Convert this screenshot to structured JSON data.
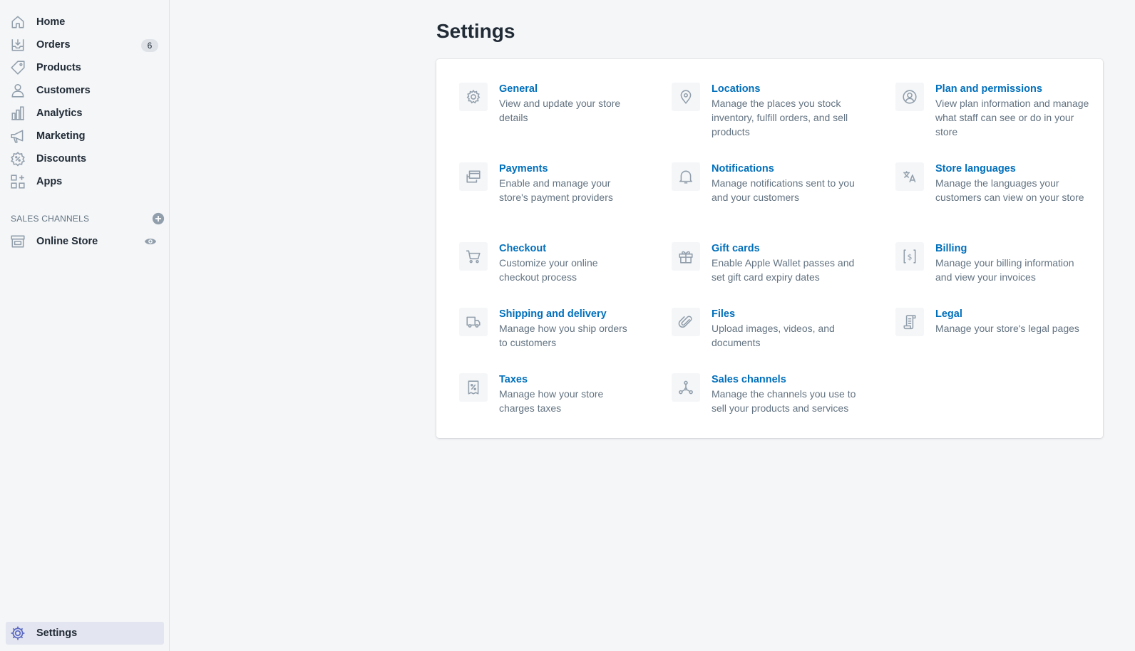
{
  "nav": {
    "items": [
      {
        "label": "Home",
        "icon": "home-icon"
      },
      {
        "label": "Orders",
        "icon": "orders-icon",
        "badge": "6"
      },
      {
        "label": "Products",
        "icon": "tag-icon"
      },
      {
        "label": "Customers",
        "icon": "person-icon"
      },
      {
        "label": "Analytics",
        "icon": "bar-chart-icon"
      },
      {
        "label": "Marketing",
        "icon": "megaphone-icon"
      },
      {
        "label": "Discounts",
        "icon": "discount-icon"
      },
      {
        "label": "Apps",
        "icon": "apps-icon"
      }
    ],
    "sales_channels_title": "SALES CHANNELS",
    "online_store": "Online Store",
    "settings": "Settings",
    "active_color": "#e3e5f0"
  },
  "page": {
    "title": "Settings"
  },
  "settings": [
    {
      "title": "General",
      "desc": "View and update your store details",
      "icon": "gear-icon"
    },
    {
      "title": "Locations",
      "desc": "Manage the places you stock inventory, fulfill orders, and sell products",
      "icon": "location-pin-icon"
    },
    {
      "title": "Plan and permissions",
      "desc": "View plan information and manage what staff can see or do in your store",
      "icon": "user-circle-icon"
    },
    {
      "title": "Payments",
      "desc": "Enable and manage your store's payment providers",
      "icon": "payment-icon"
    },
    {
      "title": "Notifications",
      "desc": "Manage notifications sent to you and your customers",
      "icon": "bell-icon"
    },
    {
      "title": "Store languages",
      "desc": "Manage the languages your customers can view on your store",
      "icon": "translate-icon"
    },
    {
      "title": "Checkout",
      "desc": "Customize your online checkout process",
      "icon": "cart-icon"
    },
    {
      "title": "Gift cards",
      "desc": "Enable Apple Wallet passes and set gift card expiry dates",
      "icon": "gift-icon"
    },
    {
      "title": "Billing",
      "desc": "Manage your billing information and view your invoices",
      "icon": "billing-icon"
    },
    {
      "title": "Shipping and delivery",
      "desc": "Manage how you ship orders to customers",
      "icon": "truck-icon"
    },
    {
      "title": "Files",
      "desc": "Upload images, videos, and documents",
      "icon": "paperclip-icon"
    },
    {
      "title": "Legal",
      "desc": "Manage your store's legal pages",
      "icon": "legal-document-icon"
    },
    {
      "title": "Taxes",
      "desc": "Manage how your store charges taxes",
      "icon": "tax-receipt-icon"
    },
    {
      "title": "Sales channels",
      "desc": "Manage the channels you use to sell your products and services",
      "icon": "channels-icon"
    }
  ],
  "colors": {
    "link": "#006fbb",
    "muted": "#637381",
    "text": "#212b36",
    "background": "#f4f6f8"
  }
}
